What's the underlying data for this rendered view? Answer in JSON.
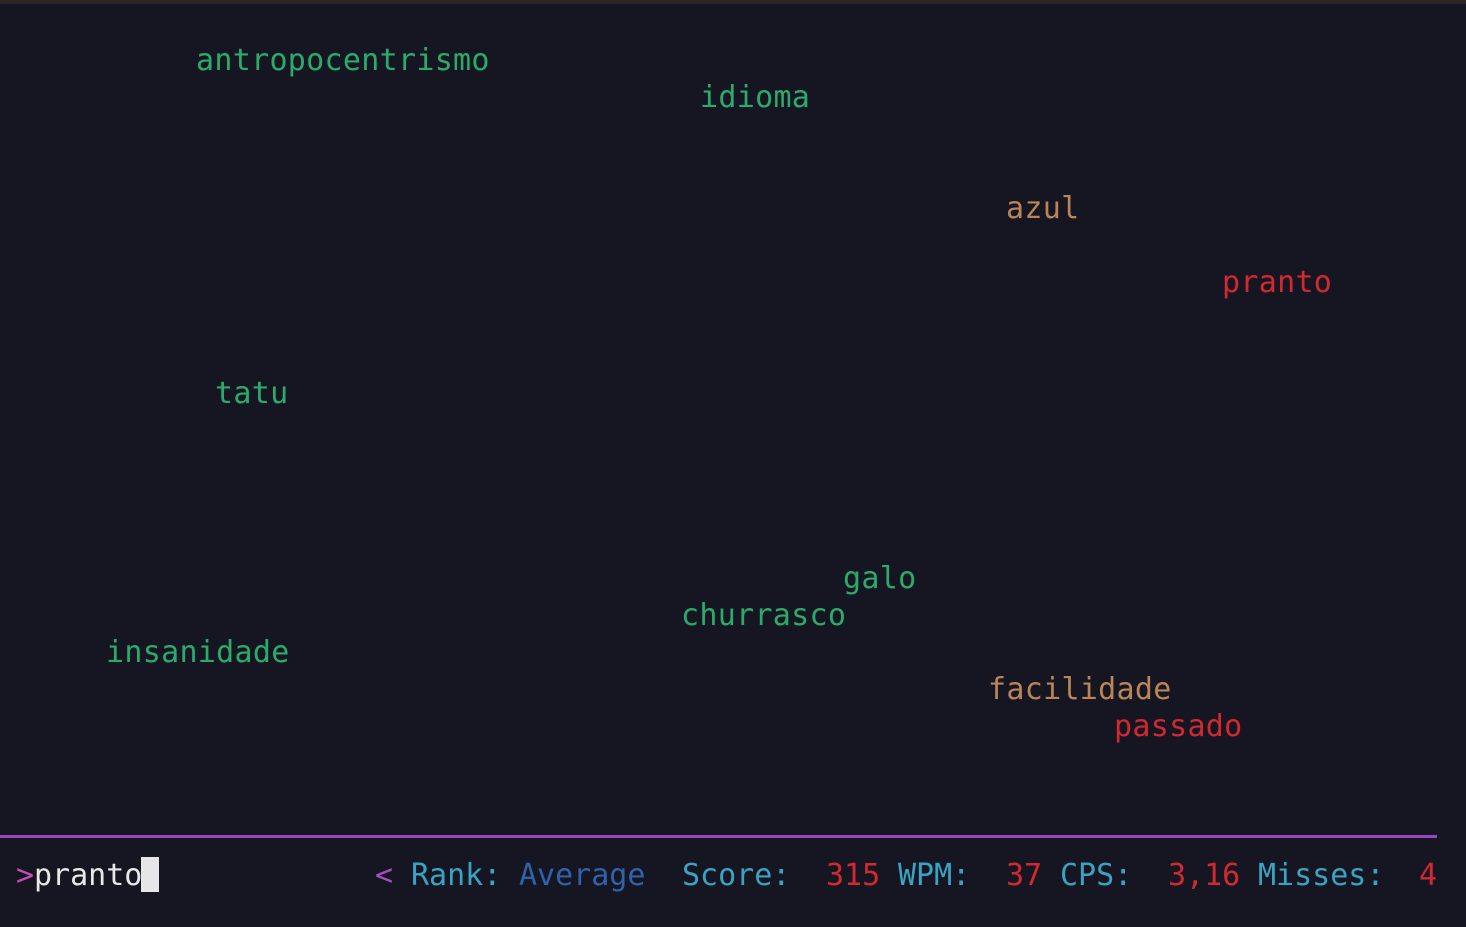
{
  "colors": {
    "background": "#161623",
    "word_safe": "#2bab6b",
    "word_warning": "#b88458",
    "word_danger": "#d2282f",
    "divider": "#9a45c0",
    "label": "#3aa3c1",
    "rank_value": "#2f62a8",
    "stat_value": "#d2282f"
  },
  "words": [
    {
      "text": "antropocentrismo",
      "state": "safe"
    },
    {
      "text": "idioma",
      "state": "safe"
    },
    {
      "text": "azul",
      "state": "warning"
    },
    {
      "text": "pranto",
      "state": "danger"
    },
    {
      "text": "tatu",
      "state": "safe"
    },
    {
      "text": "galo",
      "state": "safe"
    },
    {
      "text": "churrasco",
      "state": "safe"
    },
    {
      "text": "insanidade",
      "state": "safe"
    },
    {
      "text": "facilidade",
      "state": "warning"
    },
    {
      "text": "passado",
      "state": "danger"
    }
  ],
  "input": {
    "prompt": ">",
    "typed": "pranto"
  },
  "status": {
    "arrow": "<",
    "rank_label": "Rank:",
    "rank_value": "Average",
    "score_label": "Score:",
    "score_value": "315",
    "wpm_label": "WPM:",
    "wpm_value": "37",
    "cps_label": "CPS:",
    "cps_value": "3,16",
    "misses_label": "Misses:",
    "misses_value": "4"
  }
}
